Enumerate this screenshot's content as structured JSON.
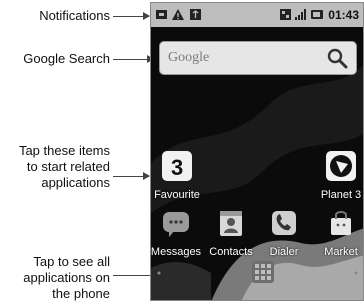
{
  "callouts": {
    "notifications": "Notifications",
    "google_search": "Google Search",
    "tap_items_line1": "Tap these items",
    "tap_items_line2": "to start related",
    "tap_items_line3": "applications",
    "tap_all_line1": "Tap to see all",
    "tap_all_line2": "applications on",
    "tap_all_line3": "the phone"
  },
  "statusbar": {
    "time": "01:43",
    "left_icons": [
      "usb-debug-icon",
      "warning-icon",
      "usb-icon"
    ],
    "right_icons": [
      "signal-icon",
      "network-bars-icon",
      "battery-icon"
    ]
  },
  "search": {
    "placeholder": "Google"
  },
  "apps": {
    "favourites": "Favourite",
    "planet3": "Planet 3",
    "messages": "Messages",
    "contacts": "Contacts",
    "dialer": "Dialer",
    "market": "Market"
  }
}
